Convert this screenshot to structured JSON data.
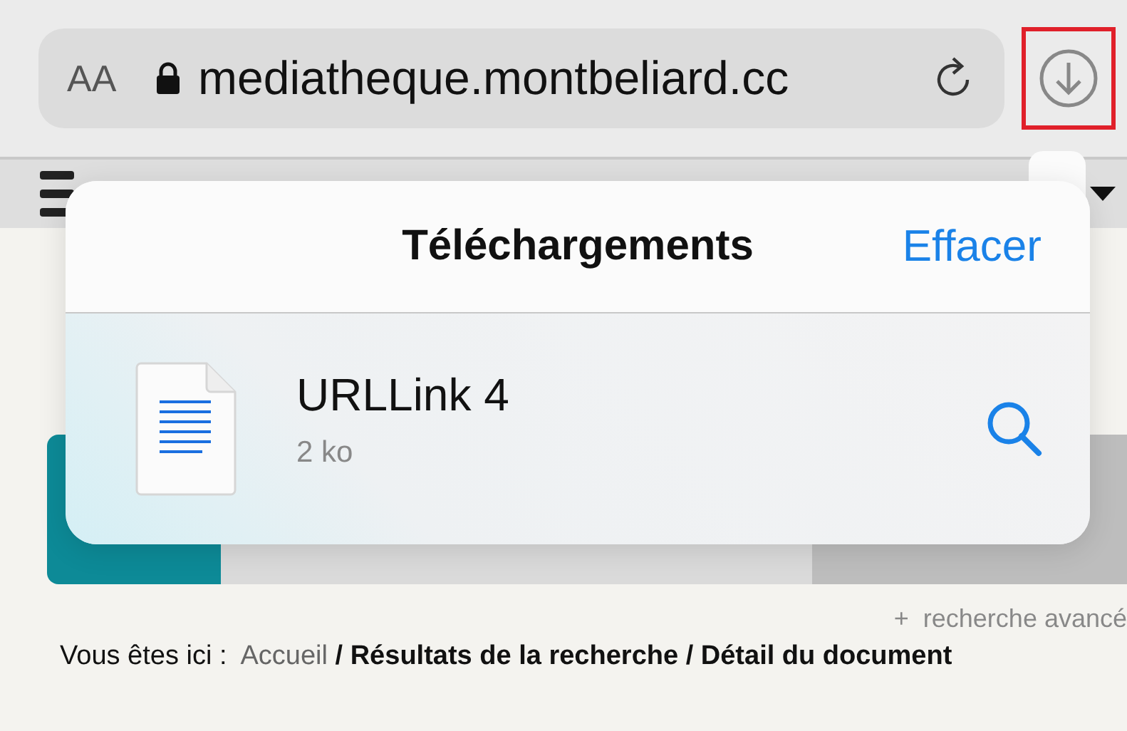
{
  "address_bar": {
    "text_size": "AA",
    "url": "mediatheque.montbeliard.cc"
  },
  "site": {
    "advanced_search": {
      "symbol": "+",
      "label": "recherche avancé"
    },
    "breadcrumb": {
      "label": "Vous êtes ici :",
      "link": "Accueil",
      "trail": "/ Résultats de la recherche / Détail du document"
    }
  },
  "downloads_popover": {
    "title": "Téléchargements",
    "clear_button": "Effacer",
    "items": [
      {
        "name": "URLLink 4",
        "size": "2 ko"
      }
    ]
  }
}
